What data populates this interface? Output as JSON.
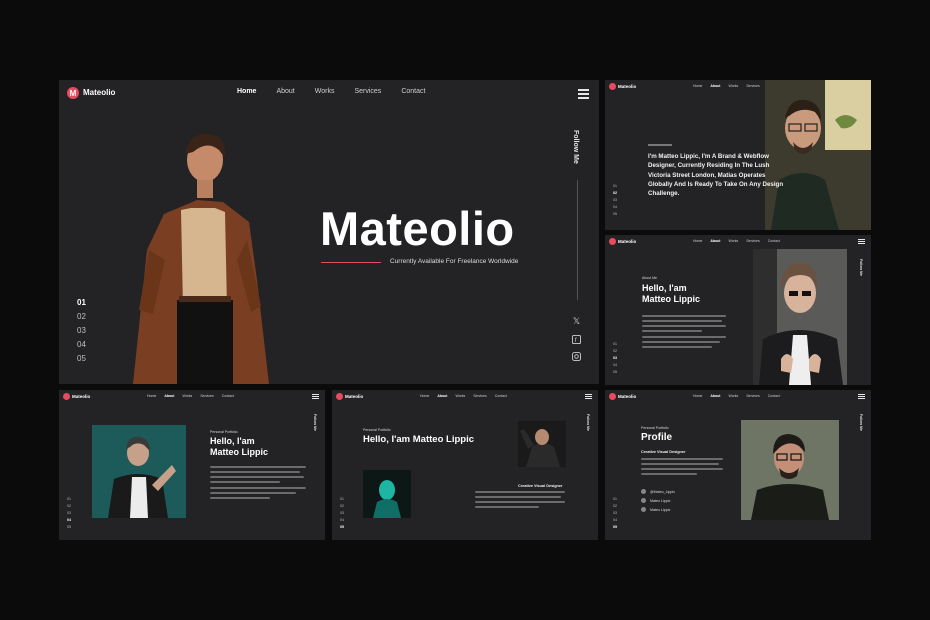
{
  "colors": {
    "accent": "#e64b5f",
    "panel": "#232325",
    "background": "#0b0b0c"
  },
  "main": {
    "logo_letter": "M",
    "brand": "Mateolio",
    "nav": [
      "Home",
      "About",
      "Works",
      "Services",
      "Contact"
    ],
    "active_nav": "Home",
    "hero_title": "Mateolio",
    "hero_subtitle": "Currently Available For Freelance Worldwide",
    "follow": "Follow Me",
    "numbers": [
      "01",
      "02",
      "03",
      "04",
      "05"
    ],
    "current_number": "01",
    "social_icons": [
      "x-icon",
      "facebook-icon",
      "instagram-icon"
    ]
  },
  "about": {
    "brand": "Mateolio",
    "nav": [
      "Home",
      "About",
      "Works",
      "Services",
      "Contact"
    ],
    "intro": "I'm Matteo Lippic, I'm A Brand & Webflow Designer, Currently Residing In The Lush Victoria Street London, Matias Operates Globally And Is Ready To Take On Any Design Challenge.",
    "numbers": [
      "01",
      "02",
      "03",
      "04",
      "05"
    ]
  },
  "hello": {
    "brand": "Mateolio",
    "nav": [
      "Home",
      "About",
      "Works",
      "Services",
      "Contact"
    ],
    "label": "About Me",
    "title1": "Hello, I'am",
    "title2": "Matteo Lippic",
    "numbers": [
      "01",
      "02",
      "03",
      "04",
      "05"
    ]
  },
  "portfolio1": {
    "brand": "Mateolio",
    "nav": [
      "Home",
      "About",
      "Works",
      "Services",
      "Contact"
    ],
    "label": "Personal Portfolio",
    "title1": "Hello, I'am",
    "title2": "Matteo Lippic",
    "numbers": [
      "01",
      "02",
      "03",
      "04",
      "05"
    ]
  },
  "portfolio2": {
    "brand": "Mateolio",
    "nav": [
      "Home",
      "About",
      "Works",
      "Services",
      "Contact"
    ],
    "label": "Personal Portfolio",
    "title": "Hello, I'am Matteo Lippic",
    "role": "Creative Visual Designer",
    "numbers": [
      "01",
      "02",
      "03",
      "04",
      "05"
    ]
  },
  "profile": {
    "brand": "Mateolio",
    "nav": [
      "Home",
      "About",
      "Works",
      "Services",
      "Contact"
    ],
    "label": "Personal Portfolio",
    "title": "Profile",
    "role": "Creative Visual Designer",
    "contacts": [
      "@Mateo_Lippic",
      "Mateo Lippic",
      "Mateo Lippic"
    ],
    "numbers": [
      "01",
      "02",
      "03",
      "04",
      "05"
    ]
  }
}
